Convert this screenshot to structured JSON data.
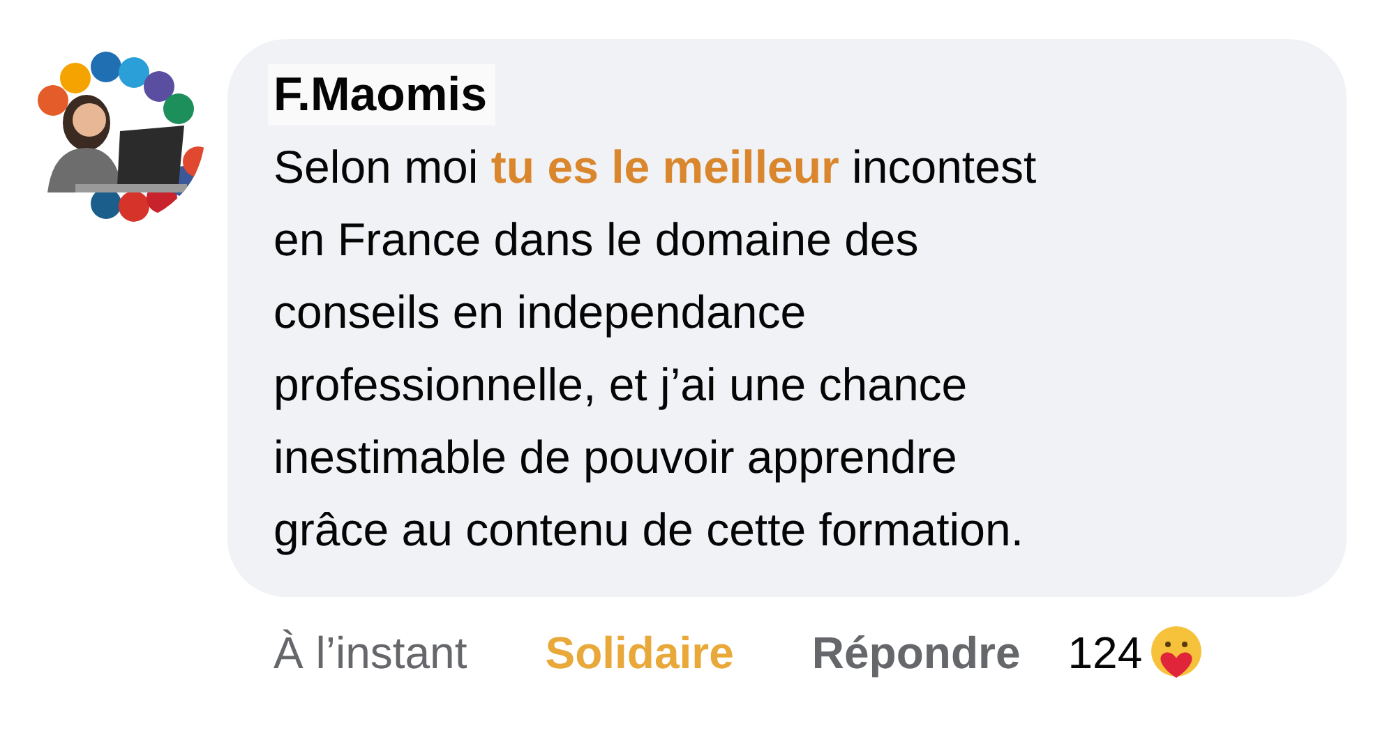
{
  "comment": {
    "author": "F.Maomis",
    "text": "Selon moi **tu es le meilleur** incontest\nen France dans le domaine des\nconseils en independance\nprofessionnelle, et j’ai une chance\ninestimable de pouvoir apprendre\ngrâce au contenu de cette formation.",
    "time": "À l’instant",
    "reaction_label": "Solidaire",
    "reply_label": "Répondre",
    "reaction_count": "124"
  }
}
